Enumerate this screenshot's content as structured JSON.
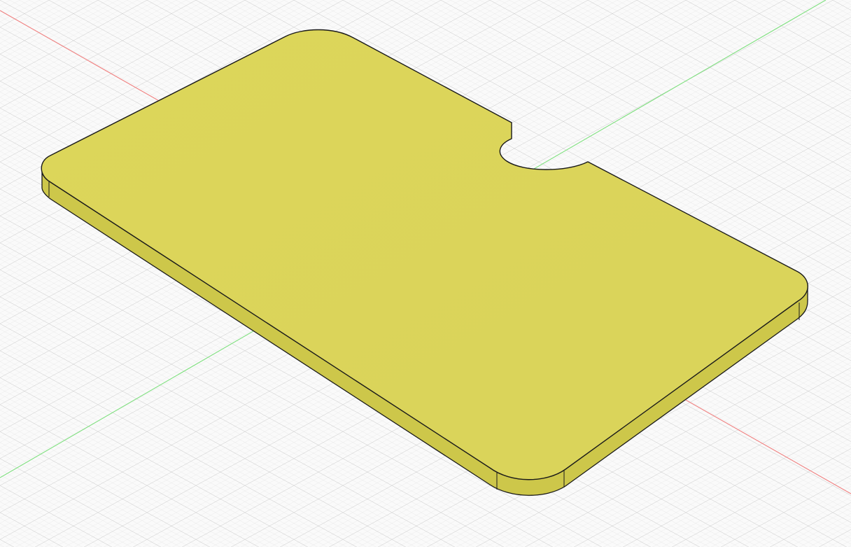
{
  "viewport": {
    "background_color": "#fafafa",
    "grid_minor_color": "#e2e2e2",
    "grid_major_color": "#c9c9c9",
    "x_axis_color": "#f08080",
    "y_axis_color": "#7fe07f"
  },
  "model": {
    "shape": "rounded rectangular plate with semicircular notch",
    "top_face_color": "#ded85a",
    "side_face_color": "#cdc74a",
    "outline_color": "#1a1a1a"
  }
}
